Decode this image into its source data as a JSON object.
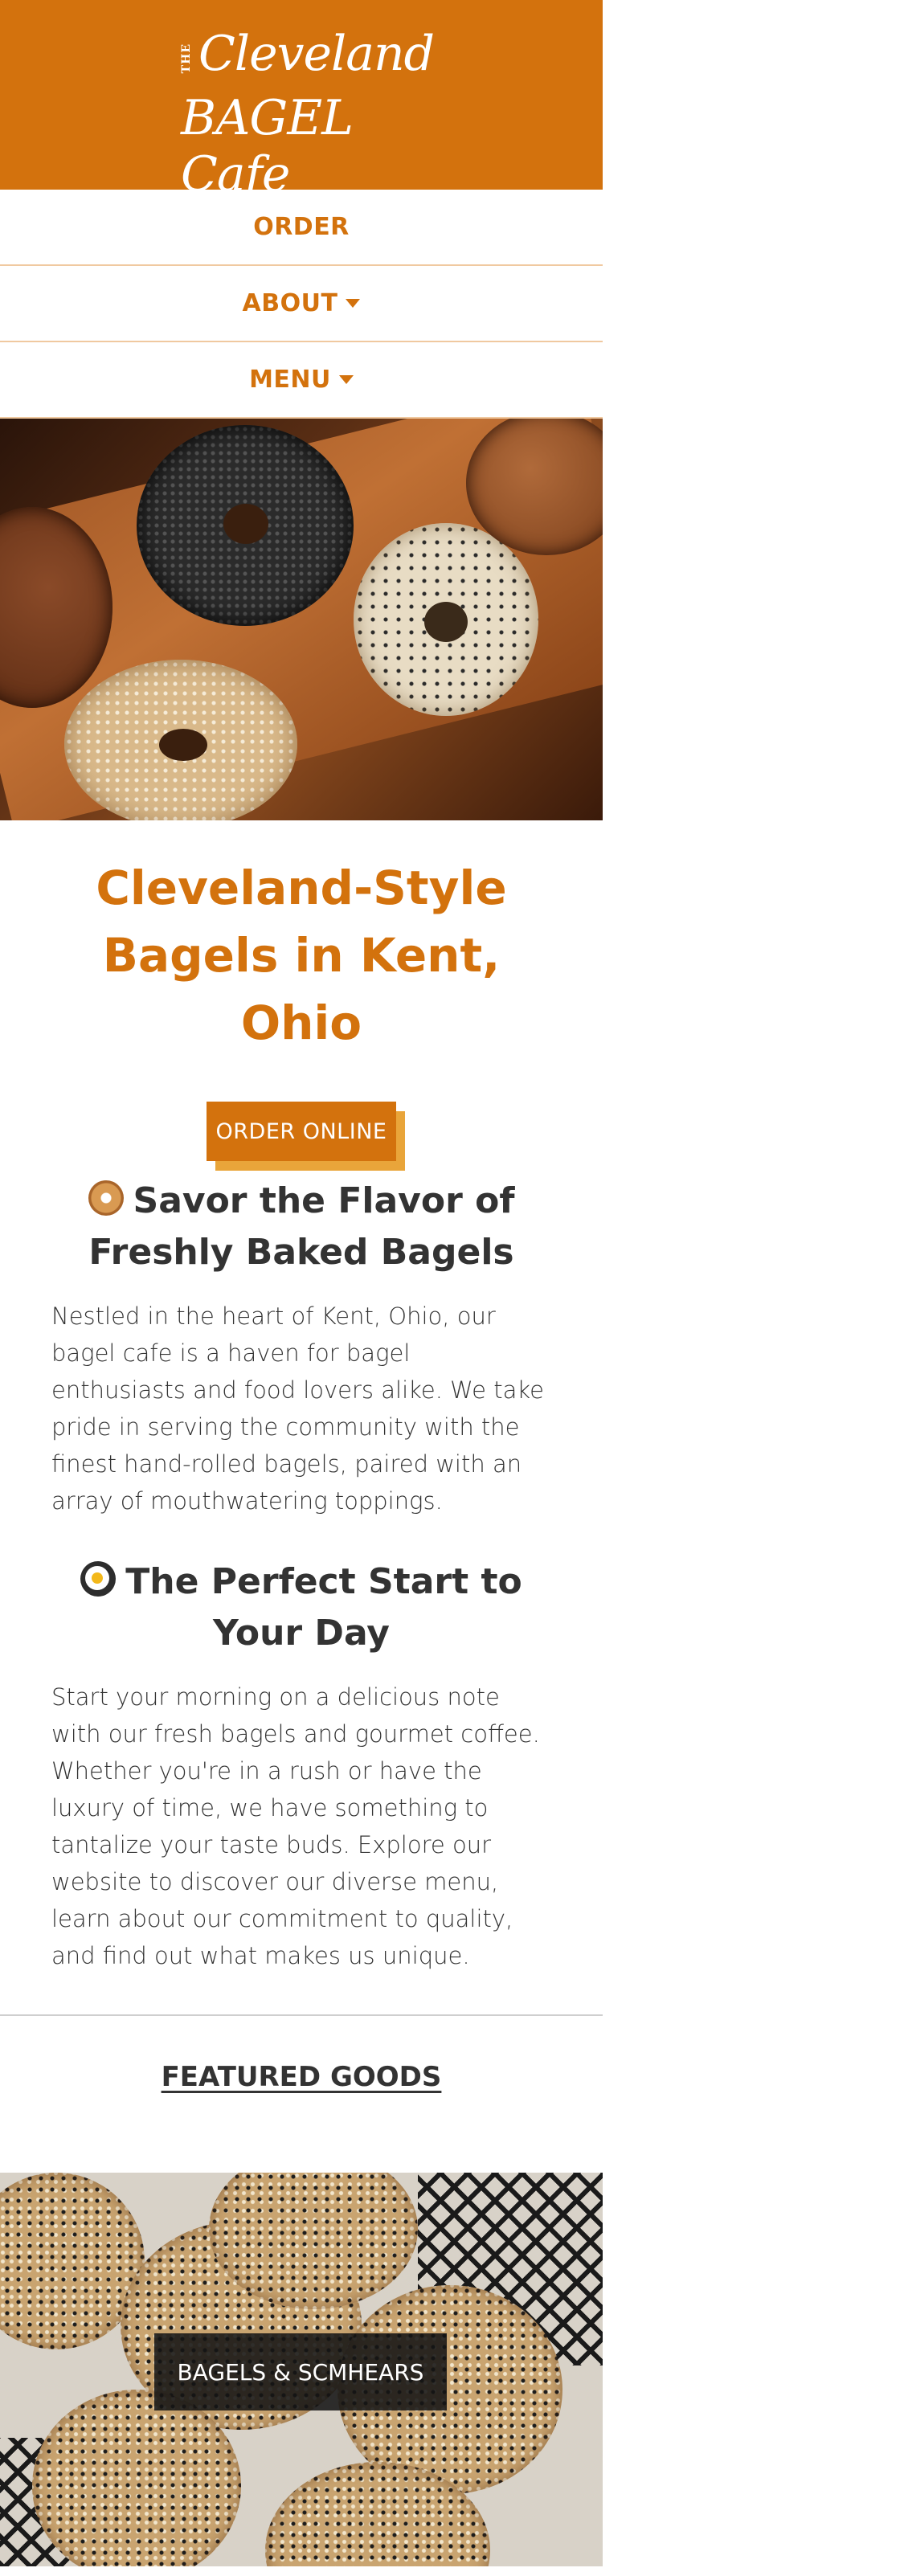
{
  "header": {
    "logo_the": "THE",
    "logo_line1": "Cleveland",
    "logo_line2": "BAGEL Cafe",
    "background_color": "#d3720d"
  },
  "nav": {
    "items": [
      {
        "label": "ORDER",
        "has_dropdown": false
      },
      {
        "label": "ABOUT",
        "has_dropdown": true
      },
      {
        "label": "MENU",
        "has_dropdown": true
      }
    ],
    "text_color": "#d3720d"
  },
  "main": {
    "title": "Cleveland-Style Bagels in Kent, Ohio",
    "order_button_label": "ORDER ONLINE",
    "sections": [
      {
        "icon": "bagel-icon",
        "heading": "Savor the Flavor of Freshly Baked Bagels",
        "body": "Nestled in the heart of Kent, Ohio, our bagel cafe is a haven for bagel enthusiasts and food lovers alike. We take pride in serving the community with the finest hand-rolled bagels, paired with an array of mouthwatering toppings."
      },
      {
        "icon": "frying-egg-icon",
        "heading": "The Perfect Start to Your Day",
        "body": "Start your morning on a delicious note with our fresh bagels and gourmet coffee. Whether you're in a rush or have the luxury of time, we have something to tantalize your taste buds. Explore our website to discover our diverse menu, learn about our commitment to quality, and find out what makes us unique."
      }
    ]
  },
  "featured": {
    "heading": "FEATURED GOODS",
    "items": [
      {
        "label": "BAGELS & SCMHEARS"
      }
    ]
  }
}
